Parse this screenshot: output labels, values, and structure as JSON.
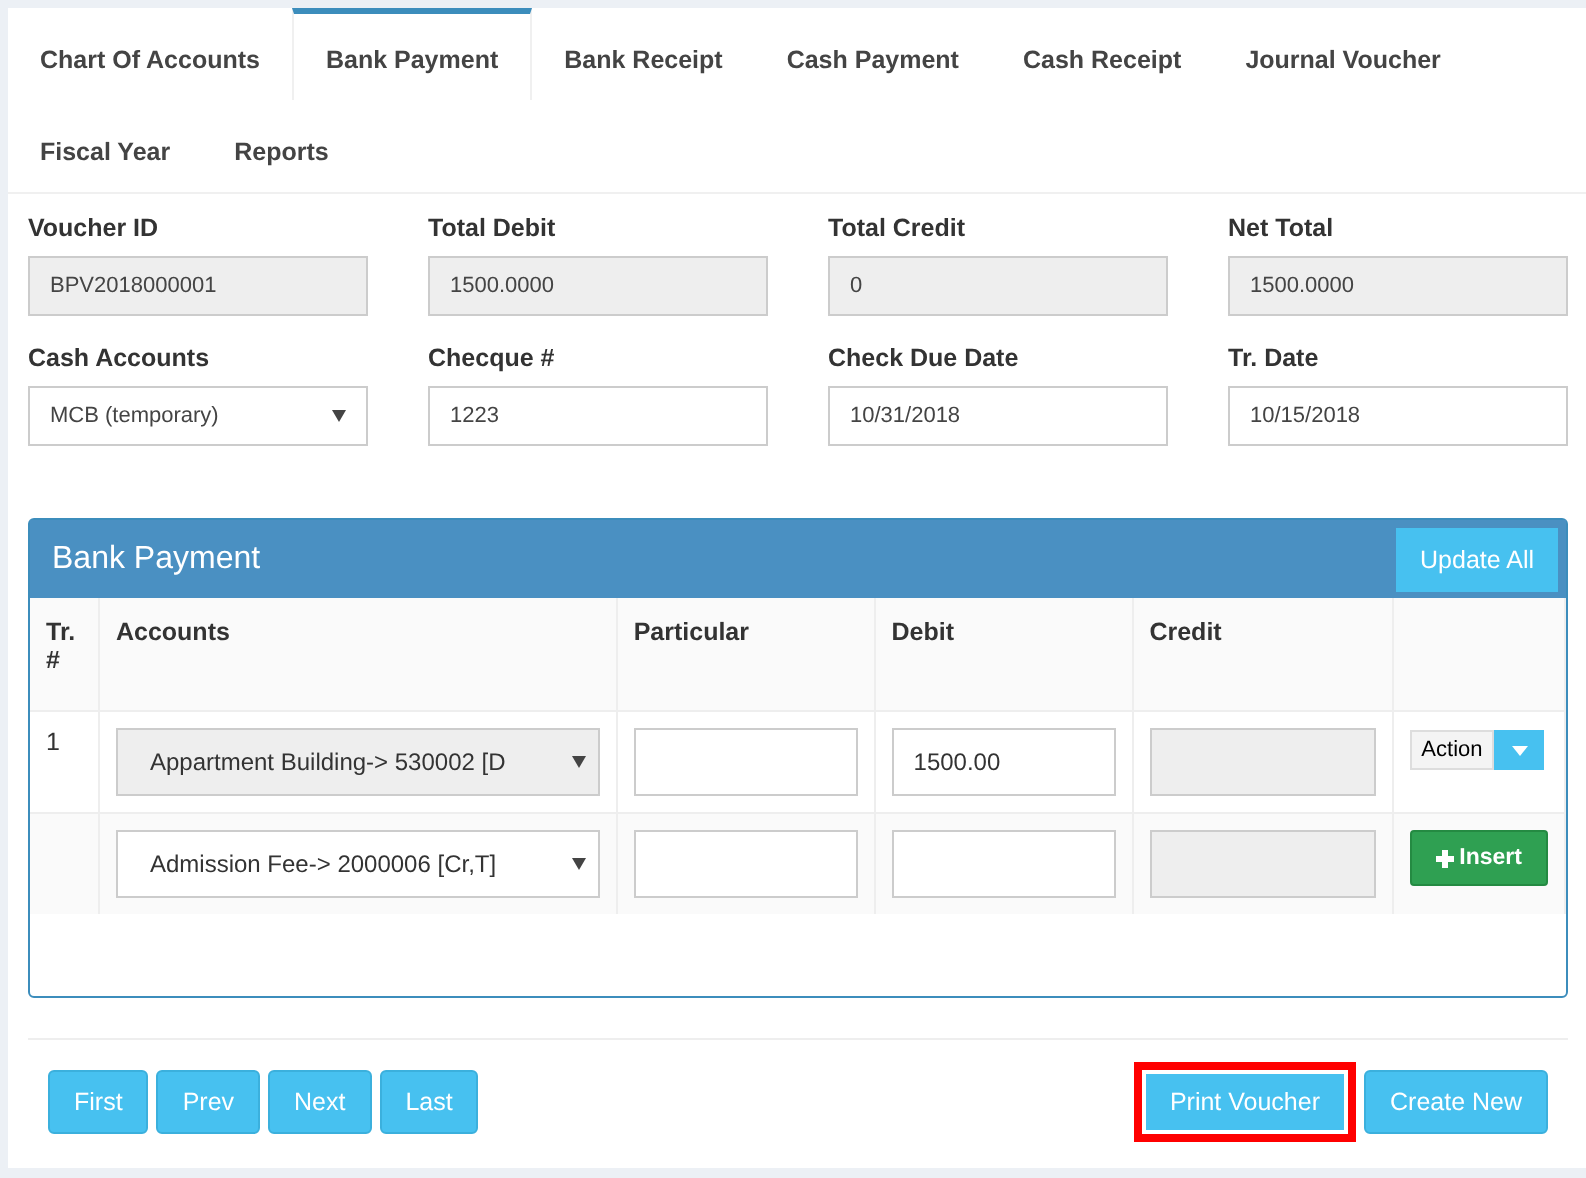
{
  "tabs": [
    {
      "label": "Chart Of Accounts",
      "selected": false
    },
    {
      "label": "Bank Payment",
      "selected": true
    },
    {
      "label": "Bank Receipt",
      "selected": false
    },
    {
      "label": "Cash Payment",
      "selected": false
    },
    {
      "label": "Cash Receipt",
      "selected": false
    },
    {
      "label": "Journal Voucher",
      "selected": false
    },
    {
      "label": "Fiscal Year",
      "selected": false
    },
    {
      "label": "Reports",
      "selected": false
    }
  ],
  "fields": [
    {
      "label": "Voucher ID",
      "value": "BPV2018000001",
      "kind": "readonly"
    },
    {
      "label": "Total Debit",
      "value": "1500.0000",
      "kind": "readonly"
    },
    {
      "label": "Total Credit",
      "value": "0",
      "kind": "readonly"
    },
    {
      "label": "Net Total",
      "value": "1500.0000",
      "kind": "readonly"
    },
    {
      "label": "Cash Accounts",
      "value": "MCB (temporary)",
      "kind": "select"
    },
    {
      "label": "Checque #",
      "value": "1223",
      "kind": "text"
    },
    {
      "label": "Check Due Date",
      "value": "10/31/2018",
      "kind": "text"
    },
    {
      "label": "Tr. Date",
      "value": "10/15/2018",
      "kind": "text"
    }
  ],
  "panel": {
    "title": "Bank Payment",
    "update_button": "Update All",
    "columns": [
      "Tr. #",
      "Accounts",
      "Particular",
      "Debit",
      "Credit"
    ],
    "rows": [
      {
        "tr": "1",
        "account": "Appartment Building-> 530002 [D",
        "account_disabled": true,
        "debit": "1500.00",
        "action": {
          "kind": "dropdown",
          "label": "Action"
        }
      },
      {
        "account": "Admission Fee-> 2000006 [Cr,T]",
        "account_disabled": false,
        "action": {
          "kind": "insert",
          "label": "Insert"
        }
      }
    ]
  },
  "nav_buttons": [
    "First",
    "Prev",
    "Next",
    "Last"
  ],
  "actions": [
    {
      "label": "Print Voucher",
      "highlighted": true
    },
    {
      "label": "Create New",
      "highlighted": false
    }
  ]
}
